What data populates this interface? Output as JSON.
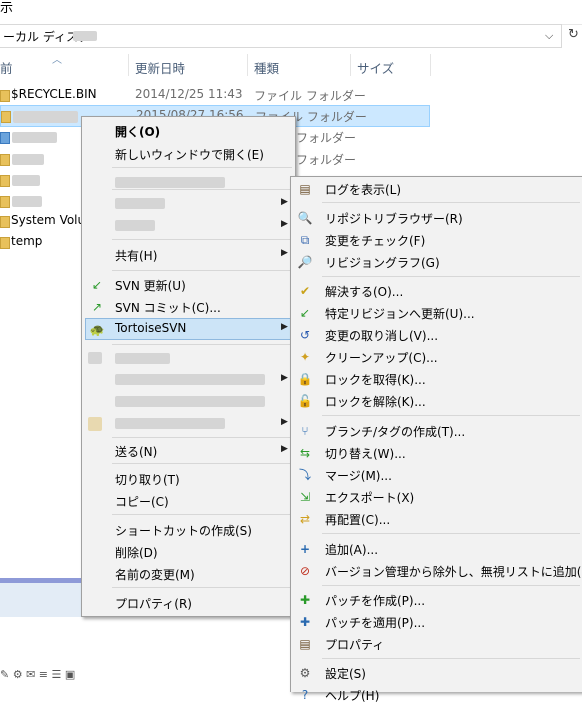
{
  "window": {
    "title_fragment": "示"
  },
  "address": {
    "path": "ーカル ディスク",
    "chevron": "⌵",
    "refresh": "↻"
  },
  "columns": [
    {
      "label": "前"
    },
    {
      "label": "更新日時"
    },
    {
      "label": "種類"
    },
    {
      "label": "サイズ"
    }
  ],
  "files": [
    {
      "name": "$RECYCLE.BIN",
      "date": "2014/12/25 11:43",
      "type": "ファイル フォルダー"
    },
    {
      "name": "",
      "date": "2015/08/27 16:56",
      "type": "ファイル フォルダー"
    },
    {
      "name": "",
      "date": "",
      "type": "フォルダー"
    },
    {
      "name": "",
      "date": "",
      "type": "フォルダー"
    },
    {
      "name": "",
      "date": "",
      "type": ""
    },
    {
      "name": "System Volu",
      "date": "",
      "type": ""
    },
    {
      "name": "temp",
      "date": "",
      "type": ""
    }
  ],
  "context_menu": {
    "open": "開く(O)",
    "open_new_window": "新しいウィンドウで開く(E)",
    "share": "共有(H)",
    "svn_update": "SVN 更新(U)",
    "svn_commit": "SVN コミット(C)...",
    "tortoisesvn": "TortoiseSVN",
    "send_to": "送る(N)",
    "cut": "切り取り(T)",
    "copy": "コピー(C)",
    "create_shortcut": "ショートカットの作成(S)",
    "delete": "削除(D)",
    "rename": "名前の変更(M)",
    "properties": "プロパティ(R)"
  },
  "svn_submenu": {
    "items": [
      {
        "label": "ログを表示(L)",
        "icon": "log-icon"
      },
      {
        "label": "リポジトリブラウザー(R)",
        "icon": "repo-browser-icon"
      },
      {
        "label": "変更をチェック(F)",
        "icon": "check-modifications-icon"
      },
      {
        "label": "リビジョングラフ(G)",
        "icon": "revision-graph-icon"
      },
      {
        "label": "解決する(O)...",
        "icon": "resolve-icon"
      },
      {
        "label": "特定リビジョンへ更新(U)...",
        "icon": "update-to-revision-icon"
      },
      {
        "label": "変更の取り消し(V)...",
        "icon": "revert-icon"
      },
      {
        "label": "クリーンアップ(C)...",
        "icon": "cleanup-icon"
      },
      {
        "label": "ロックを取得(K)...",
        "icon": "lock-icon"
      },
      {
        "label": "ロックを解除(K)...",
        "icon": "unlock-icon"
      },
      {
        "label": "ブランチ/タグの作成(T)...",
        "icon": "branch-icon"
      },
      {
        "label": "切り替え(W)...",
        "icon": "switch-icon"
      },
      {
        "label": "マージ(M)...",
        "icon": "merge-icon"
      },
      {
        "label": "エクスポート(X)",
        "icon": "export-icon"
      },
      {
        "label": "再配置(C)...",
        "icon": "relocate-icon"
      },
      {
        "label": "追加(A)...",
        "icon": "add-icon"
      },
      {
        "label": "バージョン管理から除外し、無視リストに追加(I)",
        "icon": "ignore-icon"
      },
      {
        "label": "パッチを作成(P)...",
        "icon": "create-patch-icon"
      },
      {
        "label": "パッチを適用(P)...",
        "icon": "apply-patch-icon"
      },
      {
        "label": "プロパティ",
        "icon": "properties-icon"
      },
      {
        "label": "設定(S)",
        "icon": "settings-icon"
      },
      {
        "label": "ヘルプ(H)",
        "icon": "help-icon"
      }
    ]
  },
  "colors": {
    "selection": "#cce8ff",
    "menu_bg": "#f2f2f2",
    "menu_highlight": "#cce4f7",
    "header_text": "#4c607a"
  }
}
